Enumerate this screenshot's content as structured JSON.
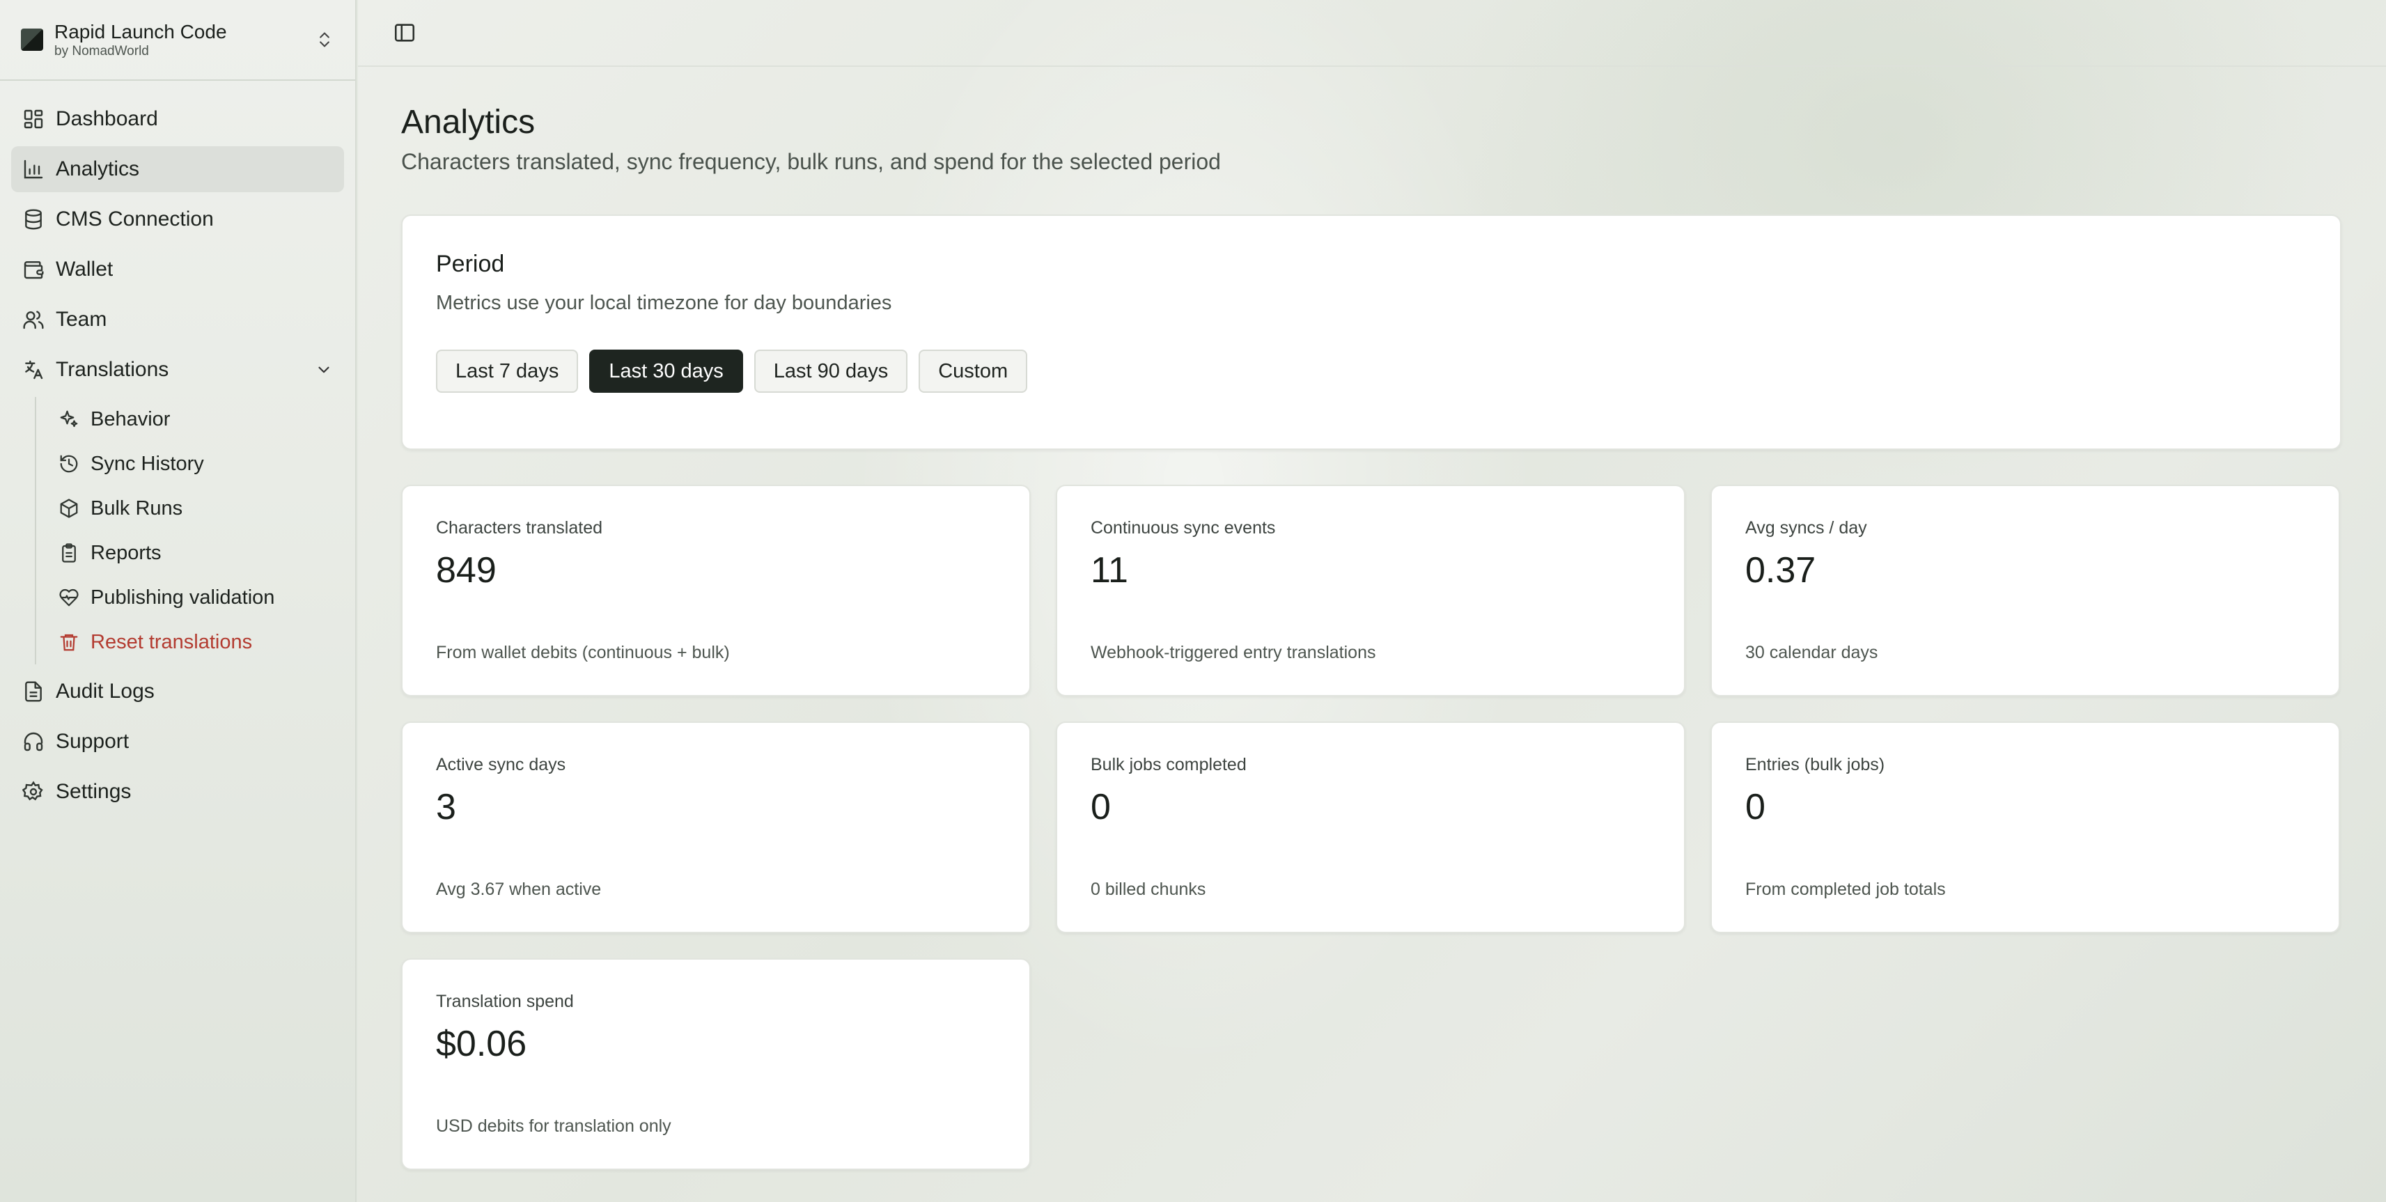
{
  "brand": {
    "name": "Rapid Launch Code",
    "sub": "by NomadWorld"
  },
  "nav": {
    "dashboard": "Dashboard",
    "analytics": "Analytics",
    "cms": "CMS Connection",
    "wallet": "Wallet",
    "team": "Team",
    "translations": "Translations",
    "sub": {
      "behavior": "Behavior",
      "sync_history": "Sync History",
      "bulk_runs": "Bulk Runs",
      "reports": "Reports",
      "publishing": "Publishing validation",
      "reset": "Reset translations"
    },
    "audit": "Audit Logs",
    "support": "Support",
    "settings": "Settings"
  },
  "page": {
    "title": "Analytics",
    "subtitle": "Characters translated, sync frequency, bulk runs, and spend for the selected period"
  },
  "period": {
    "title": "Period",
    "subtitle": "Metrics use your local timezone for day boundaries",
    "options": [
      "Last 7 days",
      "Last 30 days",
      "Last 90 days",
      "Custom"
    ],
    "selected": "Last 30 days"
  },
  "stats": [
    {
      "label": "Characters translated",
      "value": "849",
      "note": "From wallet debits (continuous + bulk)"
    },
    {
      "label": "Continuous sync events",
      "value": "11",
      "note": "Webhook-triggered entry translations"
    },
    {
      "label": "Avg syncs / day",
      "value": "0.37",
      "note": "30 calendar days"
    },
    {
      "label": "Active sync days",
      "value": "3",
      "note": "Avg 3.67 when active"
    },
    {
      "label": "Bulk jobs completed",
      "value": "0",
      "note": "0 billed chunks"
    },
    {
      "label": "Entries (bulk jobs)",
      "value": "0",
      "note": "From completed job totals"
    },
    {
      "label": "Translation spend",
      "value": "$0.06",
      "note": "USD debits for translation only"
    }
  ],
  "colors": {
    "accent": "#1e2520",
    "danger": "#b33b30",
    "active_bg": "#dcdfda"
  }
}
